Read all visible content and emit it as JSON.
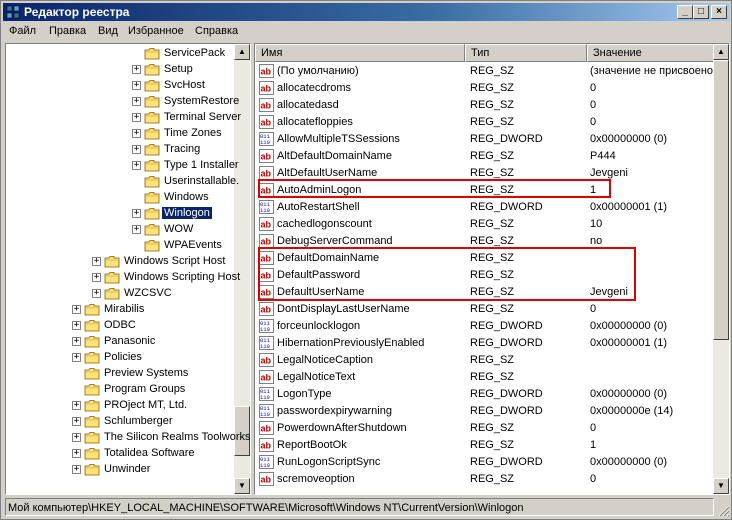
{
  "window": {
    "title": "Редактор реестра",
    "minimize_glyph": "_",
    "maximize_glyph": "□",
    "close_glyph": "×"
  },
  "menu": [
    {
      "label": "Файл"
    },
    {
      "label": "Правка"
    },
    {
      "label": "Вид"
    },
    {
      "label": "Избранное"
    },
    {
      "label": "Справка"
    }
  ],
  "tree": {
    "items": [
      {
        "label": "ServicePack",
        "level": 3,
        "expander": "none"
      },
      {
        "label": "Setup",
        "level": 3,
        "expander": "+"
      },
      {
        "label": "SvcHost",
        "level": 3,
        "expander": "+"
      },
      {
        "label": "SystemRestore",
        "level": 3,
        "expander": "+"
      },
      {
        "label": "Terminal Server",
        "level": 3,
        "expander": "+"
      },
      {
        "label": "Time Zones",
        "level": 3,
        "expander": "+"
      },
      {
        "label": "Tracing",
        "level": 3,
        "expander": "+"
      },
      {
        "label": "Type 1 Installer",
        "level": 3,
        "expander": "+"
      },
      {
        "label": "Userinstallable.",
        "level": 3,
        "expander": "none"
      },
      {
        "label": "Windows",
        "level": 3,
        "expander": "none"
      },
      {
        "label": "Winlogon",
        "level": 3,
        "expander": "+",
        "selected": true,
        "open": true
      },
      {
        "label": "WOW",
        "level": 3,
        "expander": "+"
      },
      {
        "label": "WPAEvents",
        "level": 3,
        "expander": "none"
      },
      {
        "label": "Windows Script Host",
        "level": 1,
        "expander": "+"
      },
      {
        "label": "Windows Scripting Host",
        "level": 1,
        "expander": "+"
      },
      {
        "label": "WZCSVC",
        "level": 1,
        "expander": "+"
      },
      {
        "label": "Mirabilis",
        "level": 0,
        "expander": "+"
      },
      {
        "label": "ODBC",
        "level": 0,
        "expander": "+"
      },
      {
        "label": "Panasonic",
        "level": 0,
        "expander": "+"
      },
      {
        "label": "Policies",
        "level": 0,
        "expander": "+"
      },
      {
        "label": "Preview Systems",
        "level": 0,
        "expander": "none"
      },
      {
        "label": "Program Groups",
        "level": 0,
        "expander": "none"
      },
      {
        "label": "PROject MT, Ltd.",
        "level": 0,
        "expander": "+"
      },
      {
        "label": "Schlumberger",
        "level": 0,
        "expander": "+"
      },
      {
        "label": "The Silicon Realms Toolworks",
        "level": 0,
        "expander": "+"
      },
      {
        "label": "Totalidea Software",
        "level": 0,
        "expander": "+"
      },
      {
        "label": "Unwinder",
        "level": 0,
        "expander": "+"
      }
    ]
  },
  "list": {
    "columns": {
      "name": "Имя",
      "type": "Тип",
      "data": "Значение"
    },
    "rows": [
      {
        "name": "(По умолчанию)",
        "type": "REG_SZ",
        "data": "(значение не присвоено)",
        "icon": "string-value-icon"
      },
      {
        "name": "allocatecdroms",
        "type": "REG_SZ",
        "data": "0",
        "icon": "string-value-icon"
      },
      {
        "name": "allocatedasd",
        "type": "REG_SZ",
        "data": "0",
        "icon": "string-value-icon"
      },
      {
        "name": "allocatefloppies",
        "type": "REG_SZ",
        "data": "0",
        "icon": "string-value-icon"
      },
      {
        "name": "AllowMultipleTSSessions",
        "type": "REG_DWORD",
        "data": "0x00000000 (0)",
        "icon": "binary-value-icon"
      },
      {
        "name": "AltDefaultDomainName",
        "type": "REG_SZ",
        "data": "P444",
        "icon": "string-value-icon"
      },
      {
        "name": "AltDefaultUserName",
        "type": "REG_SZ",
        "data": "Jevgeni",
        "icon": "string-value-icon"
      },
      {
        "name": "AutoAdminLogon",
        "type": "REG_SZ",
        "data": "1",
        "icon": "string-value-icon"
      },
      {
        "name": "AutoRestartShell",
        "type": "REG_DWORD",
        "data": "0x00000001 (1)",
        "icon": "binary-value-icon"
      },
      {
        "name": "cachedlogonscount",
        "type": "REG_SZ",
        "data": "10",
        "icon": "string-value-icon"
      },
      {
        "name": "DebugServerCommand",
        "type": "REG_SZ",
        "data": "no",
        "icon": "string-value-icon"
      },
      {
        "name": "DefaultDomainName",
        "type": "REG_SZ",
        "data": "",
        "icon": "string-value-icon"
      },
      {
        "name": "DefaultPassword",
        "type": "REG_SZ",
        "data": "",
        "icon": "string-value-icon"
      },
      {
        "name": "DefaultUserName",
        "type": "REG_SZ",
        "data": "Jevgeni",
        "icon": "string-value-icon"
      },
      {
        "name": "DontDisplayLastUserName",
        "type": "REG_SZ",
        "data": "0",
        "icon": "string-value-icon"
      },
      {
        "name": "forceunlocklogon",
        "type": "REG_DWORD",
        "data": "0x00000000 (0)",
        "icon": "binary-value-icon"
      },
      {
        "name": "HibernationPreviouslyEnabled",
        "type": "REG_DWORD",
        "data": "0x00000001 (1)",
        "icon": "binary-value-icon"
      },
      {
        "name": "LegalNoticeCaption",
        "type": "REG_SZ",
        "data": "",
        "icon": "string-value-icon"
      },
      {
        "name": "LegalNoticeText",
        "type": "REG_SZ",
        "data": "",
        "icon": "string-value-icon"
      },
      {
        "name": "LogonType",
        "type": "REG_DWORD",
        "data": "0x00000000 (0)",
        "icon": "binary-value-icon"
      },
      {
        "name": "passwordexpirywarning",
        "type": "REG_DWORD",
        "data": "0x0000000e (14)",
        "icon": "binary-value-icon"
      },
      {
        "name": "PowerdownAfterShutdown",
        "type": "REG_SZ",
        "data": "0",
        "icon": "string-value-icon"
      },
      {
        "name": "ReportBootOk",
        "type": "REG_SZ",
        "data": "1",
        "icon": "string-value-icon"
      },
      {
        "name": "RunLogonScriptSync",
        "type": "REG_DWORD",
        "data": "0x00000000 (0)",
        "icon": "binary-value-icon"
      },
      {
        "name": "scremoveoption",
        "type": "REG_SZ",
        "data": "0",
        "icon": "string-value-icon"
      }
    ]
  },
  "status": {
    "path": "Мой компьютер\\HKEY_LOCAL_MACHINE\\SOFTWARE\\Microsoft\\Windows NT\\CurrentVersion\\Winlogon"
  },
  "colors": {
    "titlebar_start": "#0a246a",
    "selection": "#0a246a",
    "highlight_box": "#e00000",
    "string_icon": "#c00000",
    "binary_icon": "#0000c0"
  }
}
